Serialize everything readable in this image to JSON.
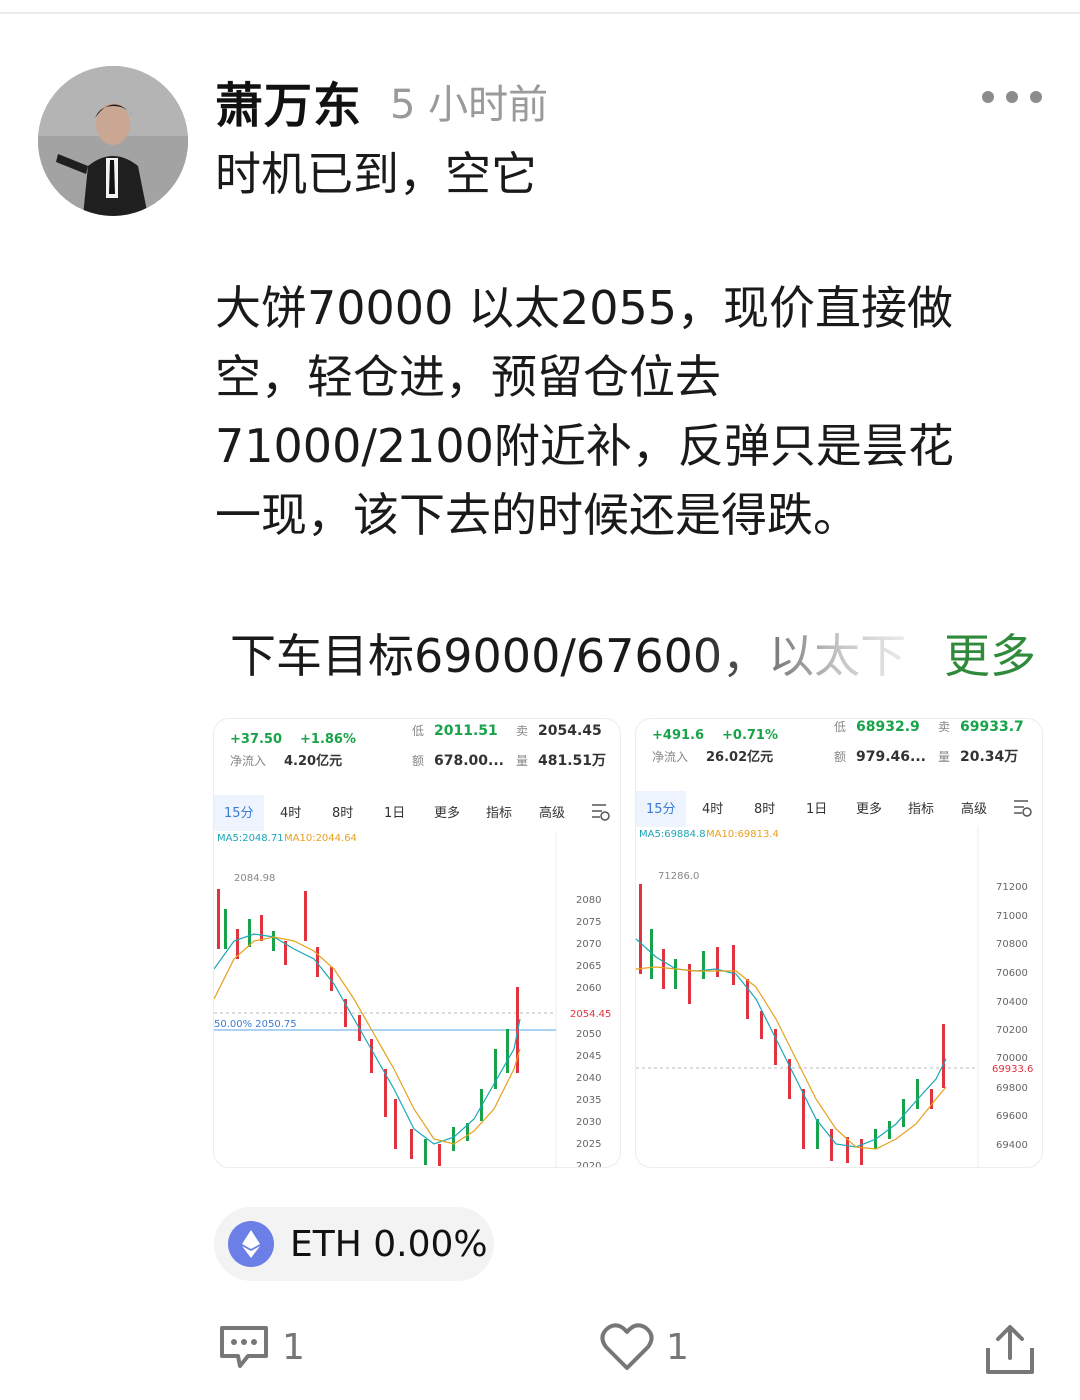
{
  "post": {
    "author": "萧万东",
    "time_ago": "5 小时前",
    "title": "时机已到，空它",
    "body_lines": [
      "大饼70000  以太2055，现价直接做",
      "空，轻仓进，预留仓位去",
      "71000/2100附近补，反弹只是昙花",
      "一现，该下去的时候还是得跌。"
    ],
    "target_line": "下车目标69000/67600，以太下",
    "more_link": "更多"
  },
  "charts": [
    {
      "change": "+37.50",
      "change_pct": "+1.86%",
      "net_inflow_label": "净流入",
      "net_inflow": "4.20亿元",
      "low_label": "低",
      "low": "2011.51",
      "sell_label": "卖",
      "sell": "2054.45",
      "amount_label": "额",
      "amount": "678.00...",
      "volume_label": "量",
      "volume": "481.51万",
      "tabs": [
        "15分",
        "4时",
        "8时",
        "1日",
        "更多",
        "指标",
        "高级"
      ],
      "ma5": "MA5:2048.71",
      "ma10": "MA10:2044.64",
      "high_mark": "2084.98",
      "fib_label": "50.00% 2050.75",
      "price_tag": "2054.45",
      "y_ticks": [
        "2080",
        "2075",
        "2070",
        "2065",
        "2060",
        "2050",
        "2045",
        "2040",
        "2035",
        "2030",
        "2025",
        "2020"
      ]
    },
    {
      "change": "+491.6",
      "change_pct": "+0.71%",
      "net_inflow_label": "净流入",
      "net_inflow": "26.02亿元",
      "low_label": "低",
      "low": "68932.9",
      "sell_label": "卖",
      "sell": "69933.7",
      "amount_label": "额",
      "amount": "979.46...",
      "volume_label": "量",
      "volume": "20.34万",
      "tabs": [
        "15分",
        "4时",
        "8时",
        "1日",
        "更多",
        "指标",
        "高级"
      ],
      "ma5": "MA5:69884.8",
      "ma10": "MA10:69813.4",
      "high_mark": "71286.0",
      "price_tag": "69933.6",
      "y_ticks": [
        "71200",
        "71000",
        "70800",
        "70600",
        "70400",
        "70200",
        "70000",
        "69800",
        "69600",
        "69400"
      ]
    }
  ],
  "tag": {
    "label": "ETH 0.00%"
  },
  "actions": {
    "comments": "1",
    "likes": "1"
  },
  "colors": {
    "up": "#18a34a",
    "down": "#e0333f",
    "accent": "#2f8a3c",
    "tab_active": "#3a7bd5",
    "ma5": "#1aa6b7",
    "ma10": "#e6a11c"
  },
  "icons": [
    "more-dots-icon",
    "comment-icon",
    "heart-icon",
    "share-icon",
    "eth-icon",
    "chart-settings-icon"
  ]
}
